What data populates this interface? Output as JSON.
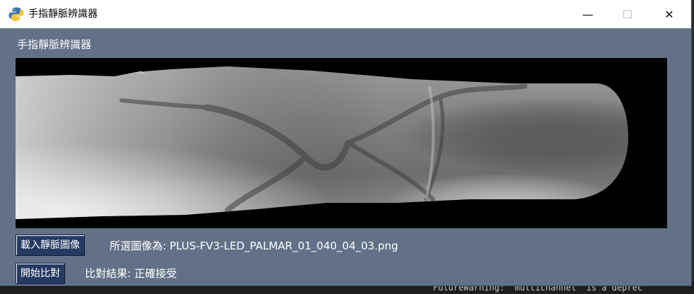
{
  "window": {
    "title": "手指靜脈辨識器",
    "minimize_glyph": "—",
    "maximize_glyph": "☐",
    "close_glyph": "✕"
  },
  "main": {
    "heading": "手指靜脈辨識器",
    "load_button": "載入靜脈圖像",
    "selected_text": "所選圖像為: PLUS-FV3-LED_PALMAR_01_040_04_03.png",
    "start_button": "開始比對",
    "result_text": "比對結果: 正確接受"
  },
  "background": {
    "console_text": "FutureWarning: `multichannel` is a deprec"
  },
  "colors": {
    "window_bg": "#627187",
    "button_bg": "#243a63",
    "title_bg": "#ffffff"
  }
}
